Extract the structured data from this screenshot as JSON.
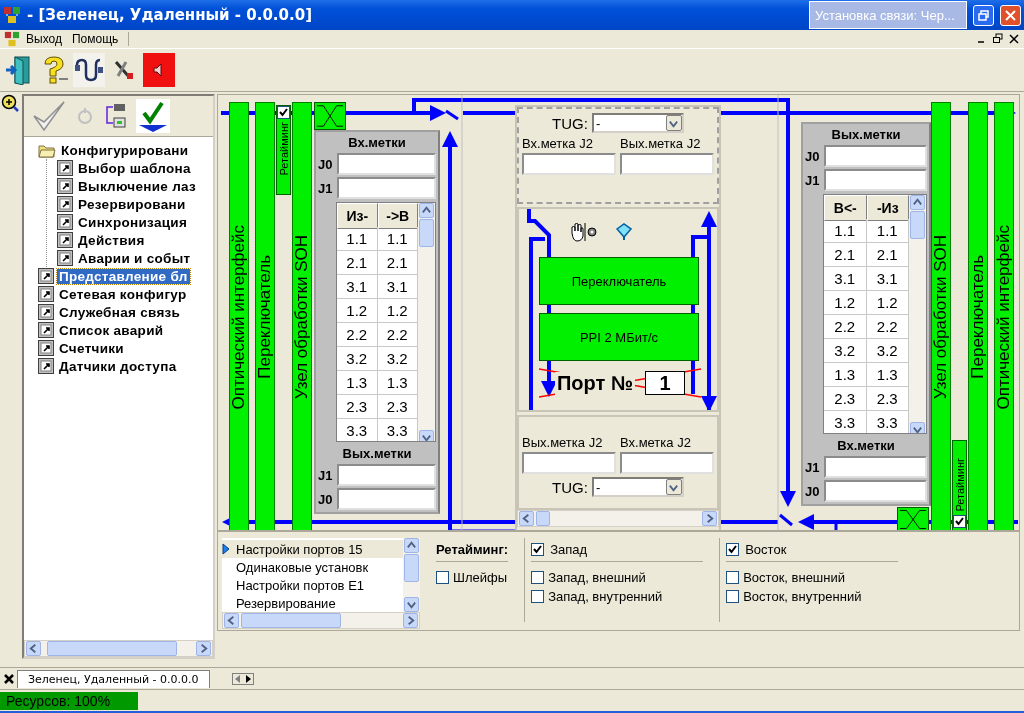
{
  "window": {
    "title": "- [Зеленец, Удаленный - 0.0.0.0]",
    "popup": "Установка связи: Чер..."
  },
  "menu": [
    "Выход",
    "Помощь"
  ],
  "tree": {
    "items": [
      {
        "label": "Конфигурировани",
        "kind": "folder",
        "selected": false,
        "children": [
          {
            "label": "Выбор шаблона",
            "kind": "shortcut",
            "selected": false
          },
          {
            "label": "Выключение лаз",
            "kind": "shortcut",
            "selected": false
          },
          {
            "label": "Резервировани",
            "kind": "shortcut",
            "selected": false
          },
          {
            "label": "Синхронизация",
            "kind": "shortcut",
            "selected": false
          },
          {
            "label": "Действия",
            "kind": "shortcut",
            "selected": false
          },
          {
            "label": "Аварии и событ",
            "kind": "shortcut",
            "selected": false
          }
        ]
      },
      {
        "label": "Представление бл",
        "kind": "shortcut",
        "selected": true
      },
      {
        "label": "Сетевая конфигур",
        "kind": "shortcut",
        "selected": false
      },
      {
        "label": "Служебная связь",
        "kind": "shortcut",
        "selected": false
      },
      {
        "label": "Список аварий",
        "kind": "shortcut",
        "selected": false
      },
      {
        "label": "Счетчики",
        "kind": "shortcut",
        "selected": false
      },
      {
        "label": "Датчики доступа",
        "kind": "shortcut",
        "selected": false
      }
    ]
  },
  "diagram": {
    "left_bars": [
      "Оптический интерфейс",
      "Переключатель",
      "Узел обработки SOH"
    ],
    "left_retiming": {
      "label": "Ретайминг",
      "checked": true
    },
    "left_panel": {
      "top_title": "Вх.метки",
      "top_fields": [
        "J0",
        "J1"
      ],
      "columns": [
        "Из-",
        "->В"
      ],
      "rows": [
        [
          "1.1",
          "1.1"
        ],
        [
          "2.1",
          "2.1"
        ],
        [
          "3.1",
          "3.1"
        ],
        [
          "1.2",
          "1.2"
        ],
        [
          "2.2",
          "2.2"
        ],
        [
          "3.2",
          "3.2"
        ],
        [
          "1.3",
          "1.3"
        ],
        [
          "2.3",
          "2.3"
        ],
        [
          "3.3",
          "3.3"
        ]
      ],
      "bottom_title": "Вых.метки",
      "bottom_fields": [
        "J1",
        "J0"
      ]
    },
    "middle": {
      "top": {
        "tug_label": "TUG:",
        "tug_value": "-",
        "labels": [
          "Вх.метка J2",
          "Вых.метка J2"
        ]
      },
      "blocks": [
        "Переключатель",
        "PPI 2 МБит/с"
      ],
      "port": {
        "label": "Порт №",
        "value": "1",
        "crossed": true
      },
      "bottom": {
        "labels": [
          "Вых.метка J2",
          "Вх.метка J2"
        ],
        "tug_label": "TUG:",
        "tug_value": "-"
      }
    },
    "right_panel": {
      "top_title": "Вых.метки",
      "top_fields": [
        "J0",
        "J1"
      ],
      "columns": [
        "В<-",
        "-Из"
      ],
      "rows": [
        [
          "1.1",
          "1.1"
        ],
        [
          "2.1",
          "2.1"
        ],
        [
          "3.1",
          "3.1"
        ],
        [
          "1.2",
          "1.2"
        ],
        [
          "2.2",
          "2.2"
        ],
        [
          "3.2",
          "3.2"
        ],
        [
          "1.3",
          "1.3"
        ],
        [
          "2.3",
          "2.3"
        ],
        [
          "3.3",
          "3.3"
        ]
      ],
      "bottom_title": "Вх.метки",
      "bottom_fields": [
        "J1",
        "J0"
      ]
    },
    "right_bars": [
      "Узел обработки SOH",
      "Переключатель",
      "Оптический интерфейс"
    ],
    "right_retiming": {
      "label": "Ретайминг",
      "checked": true
    }
  },
  "settings_list": {
    "items": [
      {
        "label": "Настройки портов 15",
        "selected": true
      },
      {
        "label": "Одинаковые установк",
        "selected": false
      },
      {
        "label": "Настройки портов E1",
        "selected": false
      },
      {
        "label": "Резервирование",
        "selected": false
      }
    ]
  },
  "retiming_options": {
    "label": "Ретайминг:",
    "loops": {
      "label": "Шлейфы",
      "checked": false
    },
    "groups": [
      {
        "label": "Запад",
        "checked": true,
        "options": [
          {
            "label": "Запад, внешний",
            "checked": false
          },
          {
            "label": "Запад, внутренний",
            "checked": false
          }
        ]
      },
      {
        "label": "Восток",
        "checked": true,
        "options": [
          {
            "label": "Восток, внешний",
            "checked": false
          },
          {
            "label": "Восток, внутренний",
            "checked": false
          }
        ]
      }
    ]
  },
  "tabs": [
    {
      "label": "Зеленец, Удаленный - 0.0.0.0",
      "selected": true
    }
  ],
  "status_bar": {
    "resources": "Ресурсов: 100%"
  }
}
